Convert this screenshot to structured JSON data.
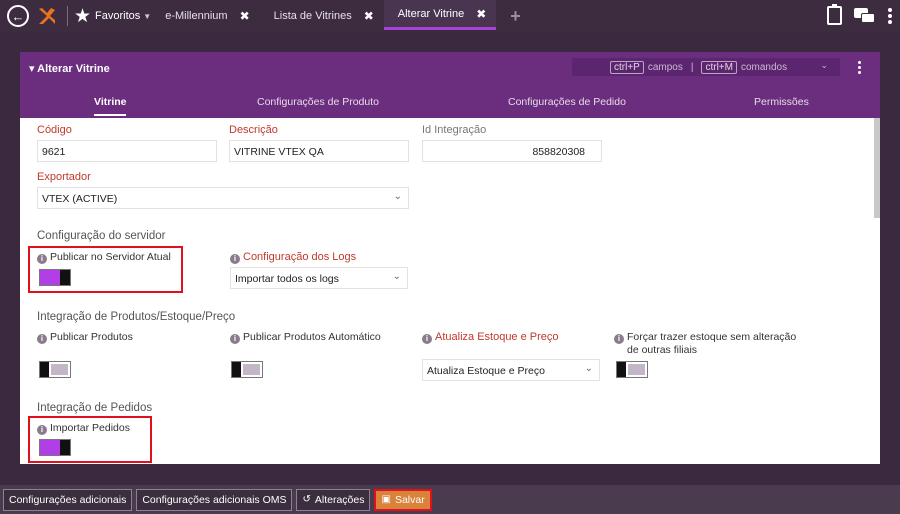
{
  "topbar": {
    "favorites_label": "Favoritos",
    "tabs": [
      {
        "label": "e-Millennium",
        "close": "✖"
      },
      {
        "label": "Lista de Vitrines",
        "close": "✖"
      },
      {
        "label": "Alterar Vitrine",
        "close": "✖"
      }
    ],
    "add_tab": "+"
  },
  "panel": {
    "title": "Alterar Vitrine",
    "shortcut_fields_key": "ctrl+P",
    "shortcut_fields_label": "campos",
    "shortcut_commands_key": "ctrl+M",
    "shortcut_commands_label": "comandos",
    "tabs": [
      "Vitrine",
      "Configurações de Produto",
      "Configurações de Pedido",
      "Permissões"
    ]
  },
  "form": {
    "codigo_label": "Código",
    "codigo_value": "9621",
    "descricao_label": "Descrição",
    "descricao_value": "VITRINE VTEX QA",
    "idintegracao_label": "Id Integração",
    "idintegracao_value": "858820308",
    "exportador_label": "Exportador",
    "exportador_value": "VTEX (ACTIVE)",
    "sec_servidor": "Configuração do servidor",
    "publicar_servidor_label": "Publicar no Servidor Atual",
    "config_logs_label": "Configuração dos Logs",
    "config_logs_value": "Importar todos os logs",
    "sec_produtos": "Integração de Produtos/Estoque/Preço",
    "publicar_produtos_label": "Publicar Produtos",
    "publicar_auto_label": "Publicar Produtos Automático",
    "atualiza_label": "Atualiza Estoque e Preço",
    "atualiza_value": "Atualiza Estoque e Preço",
    "forcar_label_1": "Forçar trazer estoque sem alteração",
    "forcar_label_2": "de outras filiais",
    "sec_pedidos": "Integração de Pedidos",
    "importar_pedidos_label": "Importar Pedidos"
  },
  "toggles": {
    "publicar_servidor": true,
    "publicar_produtos": false,
    "publicar_auto": false,
    "forcar_estoque": false,
    "importar_pedidos": true
  },
  "footer": {
    "btn_config_adicionais": "Configurações adicionais",
    "btn_config_oms": "Configurações adicionais OMS",
    "btn_alteracoes": "Alterações",
    "btn_salvar": "Salvar"
  },
  "colors": {
    "accent": "#b13ee6",
    "header": "#6b2d7e",
    "save": "#d9823a"
  }
}
